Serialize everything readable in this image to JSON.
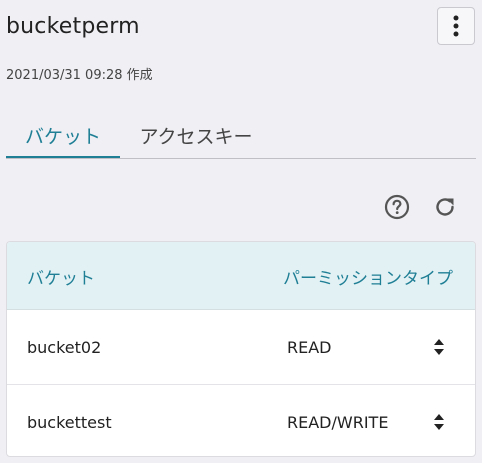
{
  "header": {
    "title": "bucketperm",
    "created": "2021/03/31 09:28 作成"
  },
  "tabs": [
    {
      "label": "バケット",
      "active": true
    },
    {
      "label": "アクセスキー",
      "active": false
    }
  ],
  "colors": {
    "accent": "#1f7f95",
    "header_bg": "#e2f1f4",
    "page_bg": "#efeff4"
  },
  "table": {
    "columns": [
      "バケット",
      "パーミッションタイプ"
    ],
    "rows": [
      {
        "bucket": "bucket02",
        "permission": "READ"
      },
      {
        "bucket": "buckettest",
        "permission": "READ/WRITE"
      }
    ]
  }
}
